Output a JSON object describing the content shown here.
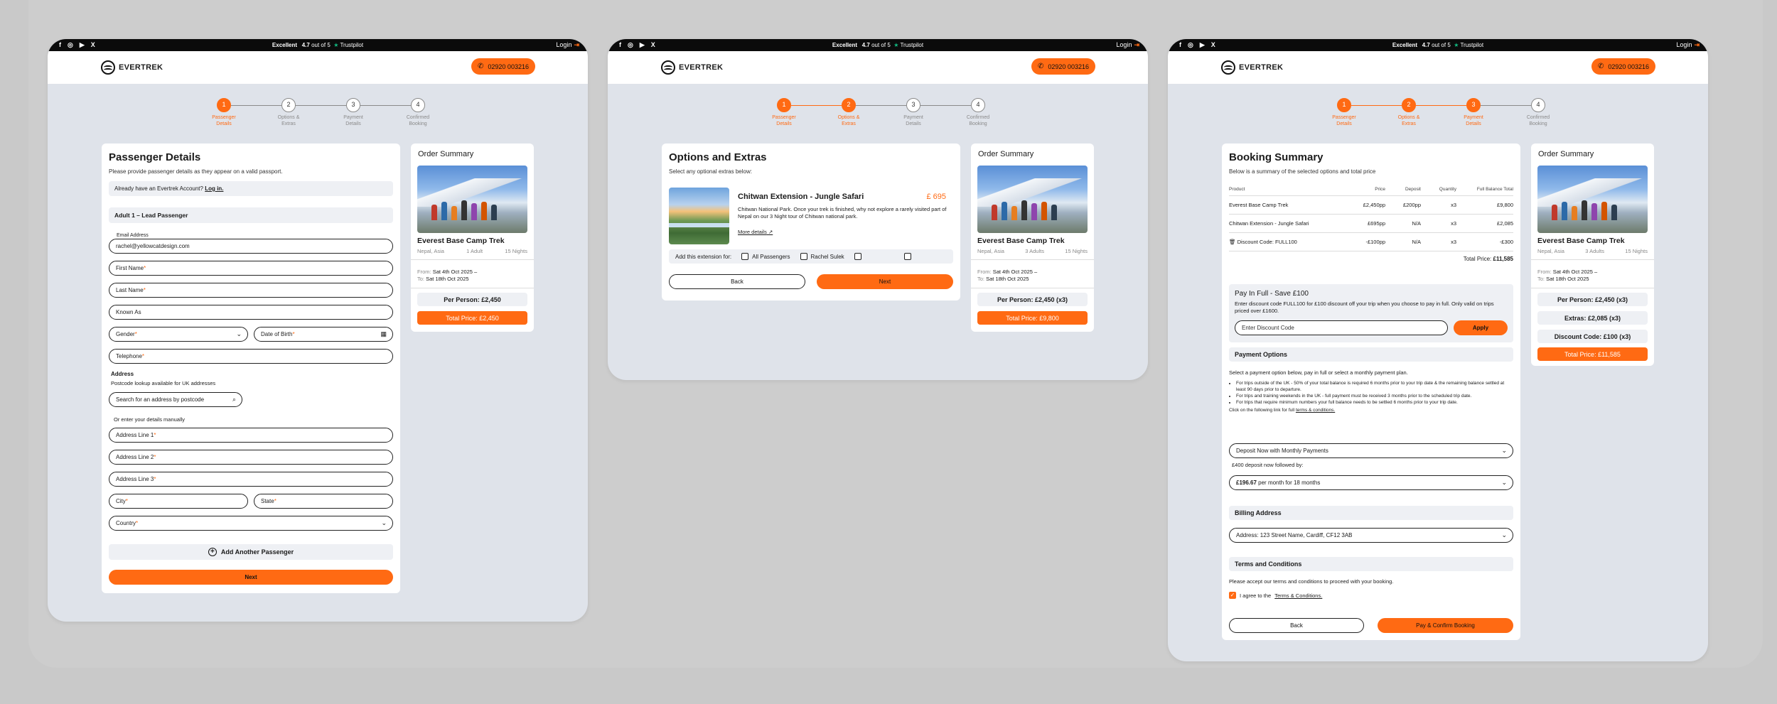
{
  "topbar": {
    "social": [
      "f",
      "◎",
      "▶",
      "X"
    ],
    "trust_rating": "Excellent",
    "trust_score": "4.7",
    "trust_out_of": "out of 5",
    "trust_brand": "Trustpilot",
    "login": "Login"
  },
  "header": {
    "brand": "EVERTREK",
    "phone": "02920 003216"
  },
  "steps": [
    {
      "num": "1",
      "label1": "Passenger",
      "label2": "Details"
    },
    {
      "num": "2",
      "label1": "Options &",
      "label2": "Extras"
    },
    {
      "num": "3",
      "label1": "Payment",
      "label2": "Details"
    },
    {
      "num": "4",
      "label1": "Confirmed",
      "label2": "Booking"
    }
  ],
  "order": {
    "title": "Order Summary",
    "trip": "Everest Base Camp Trek",
    "location": "Nepal, Asia",
    "nights": "15 Nights",
    "from": "From:",
    "from_date": "Sat 4th Oct 2025 –",
    "to": "To:",
    "to_date": "Sat 18th Oct 2025"
  },
  "screen1": {
    "title": "Passenger Details",
    "subtitle": "Please provide passenger details as they appear on a valid passport.",
    "account_q": "Already have an Evertrek Account?",
    "login_link": "Log in.",
    "adult": "Adult 1 – Lead Passenger",
    "email_label": "Email Address",
    "email_value": "rachel@yellowcatdesign.com",
    "first_name": "First Name",
    "last_name": "Last Name",
    "known_as": "Known As",
    "gender": "Gender",
    "dob": "Date of Birth",
    "telephone": "Telephone",
    "address": "Address",
    "postcode_note": "Postcode lookup available for UK addresses",
    "postcode_search": "Search for an address by postcode",
    "manual": "Or enter your details manually",
    "addr1": "Address Line 1",
    "addr2": "Address Line 2",
    "addr3": "Address Line 3",
    "city": "City",
    "state": "State",
    "country": "Country",
    "add_passenger": "Add Another Passenger",
    "next": "Next",
    "travellers": "1 Adult",
    "per_person": "Per Person: £2,450",
    "total": "Total Price: £2,450"
  },
  "screen2": {
    "title": "Options and Extras",
    "subtitle": "Select any optional extras below:",
    "ext_title": "Chitwan Extension - Jungle Safari",
    "ext_price": "£ 695",
    "ext_desc": "Chitwan National Park. Once your trek is finished, why not explore a rarely visited part of Nepal on our 3 Night tour of Chitwan national park.",
    "more": "More details",
    "add_for": "Add this extension for:",
    "all_passengers": "All Passengers",
    "passenger": "Rachel Sulek",
    "back": "Back",
    "next": "Next",
    "travellers": "3 Adults",
    "per_person": "Per Person: £2,450 (x3)",
    "total": "Total Price: £9,800"
  },
  "screen3": {
    "title": "Booking Summary",
    "subtitle": "Below is a summary of the selected options and total price",
    "table_head": [
      "Product",
      "Price",
      "Deposit",
      "Quantity",
      "Full Balance Total"
    ],
    "rows": [
      [
        "Everest Base Camp Trek",
        "£2,450pp",
        "£200pp",
        "x3",
        "£9,800"
      ],
      [
        "Chitwan Extension - Jungle Safari",
        "£695pp",
        "N/A",
        "x3",
        "£2,085"
      ],
      [
        "Discount Code: FULL100",
        "-£100pp",
        "N/A",
        "x3",
        "-£300"
      ]
    ],
    "total_label": "Total Price:",
    "total_value": "£11,585",
    "pif_title": "Pay In Full - Save £100",
    "pif_desc": "Enter discount code FULL100 for £100 discount off your trip when you choose to pay in full. Only valid on trips priced over £1600.",
    "discount_placeholder": "Enter Discount Code",
    "apply": "Apply",
    "payment_options": "Payment Options",
    "payment_intro": "Select a payment option below, pay in full or select a monthly payment plan.",
    "bullets": [
      "For trips outside of the UK - 50% of your total balance is required 6 months prior to your trip date & the remaining balance settled at least 90 days prior to departure.",
      "For trips and training weekends in the UK - full payment must be received 3 months prior to the scheduled trip date.",
      "For trips that require minimum numbers your full balance needs to be settled 6 months prior to your trip date."
    ],
    "terms_link_text": "Click on the following link for full",
    "terms_link": "terms & conditions.",
    "plan": "Deposit Now with Monthly Payments",
    "deposit_note": "£400 deposit now followed by:",
    "monthly_amount": "£196.67",
    "monthly_rest": "per month for 18 months",
    "billing": "Billing Address",
    "address": "Address: 123 Street Name, Cardiff, CF12 3AB",
    "terms": "Terms and Conditions",
    "terms_desc": "Please accept our terms and conditions to proceed with your booking.",
    "agree": "I agree to the",
    "agree_link": "Terms & Conditions.",
    "back": "Back",
    "pay": "Pay & Confirm Booking",
    "travellers": "3 Adults",
    "per_person": "Per Person: £2,450 (x3)",
    "extras": "Extras: £2,085 (x3)",
    "discount": "Discount Code: £100 (x3)",
    "total": "Total Price: £11,585"
  },
  "colors": {
    "accent": "#ff6a13",
    "page_bg": "#dfe3ea",
    "topbar": "#0b0b0b"
  }
}
